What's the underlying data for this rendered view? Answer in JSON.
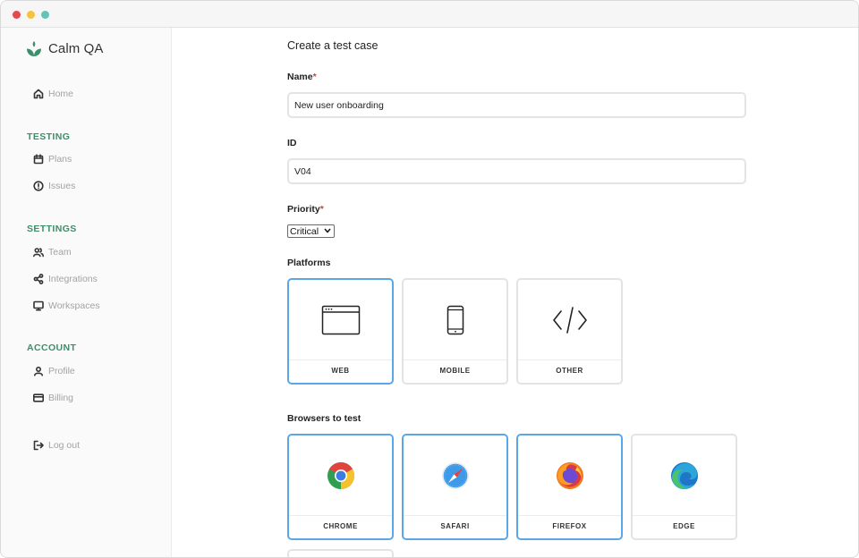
{
  "app": {
    "name": "Calm QA"
  },
  "sidebar": {
    "home": {
      "label": "Home",
      "icon": "home-icon"
    },
    "sections": [
      {
        "title": "TESTING",
        "items": [
          {
            "label": "Plans",
            "icon": "calendar-icon"
          },
          {
            "label": "Issues",
            "icon": "alert-circle-icon"
          }
        ]
      },
      {
        "title": "SETTINGS",
        "items": [
          {
            "label": "Team",
            "icon": "users-icon"
          },
          {
            "label": "Integrations",
            "icon": "share-icon"
          },
          {
            "label": "Workspaces",
            "icon": "monitor-icon"
          }
        ]
      },
      {
        "title": "ACCOUNT",
        "items": [
          {
            "label": "Profile",
            "icon": "user-icon"
          },
          {
            "label": "Billing",
            "icon": "credit-card-icon"
          }
        ]
      }
    ],
    "logout": {
      "label": "Log out",
      "icon": "log-out-icon"
    }
  },
  "form": {
    "title": "Create a test case",
    "name": {
      "label": "Name",
      "required_mark": "*",
      "value": "New user onboarding"
    },
    "id": {
      "label": "ID",
      "value": "V04"
    },
    "priority": {
      "label": "Priority",
      "required_mark": "*",
      "value": "Critical"
    },
    "platforms": {
      "label": "Platforms",
      "options": [
        {
          "label": "WEB",
          "icon": "browser-window-icon",
          "selected": true
        },
        {
          "label": "MOBILE",
          "icon": "mobile-phone-icon",
          "selected": false
        },
        {
          "label": "OTHER",
          "icon": "code-icon",
          "selected": false
        }
      ]
    },
    "browsers": {
      "label": "Browsers to test",
      "options": [
        {
          "label": "CHROME",
          "icon": "chrome-icon",
          "selected": true
        },
        {
          "label": "SAFARI",
          "icon": "safari-icon",
          "selected": true
        },
        {
          "label": "FIREFOX",
          "icon": "firefox-icon",
          "selected": true
        },
        {
          "label": "EDGE",
          "icon": "edge-icon",
          "selected": false
        }
      ]
    }
  },
  "colors": {
    "accent": "#3d8f6a",
    "selected_border": "#5ba7e6",
    "required": "#d43f3a"
  }
}
